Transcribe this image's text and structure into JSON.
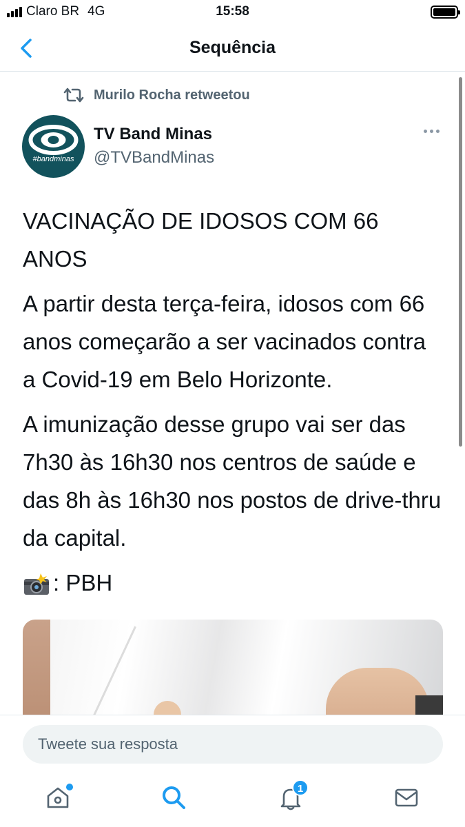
{
  "status_bar": {
    "carrier": "Claro BR",
    "network": "4G",
    "time": "15:58"
  },
  "nav": {
    "title": "Sequência"
  },
  "tweet": {
    "retweeted_by": "Murilo Rocha retweetou",
    "avatar_text": "#bandminas",
    "author_name": "TV Band Minas",
    "author_handle": "@TVBandMinas",
    "paragraphs": [
      "VACINAÇÃO DE IDOSOS COM 66 ANOS",
      "A partir desta terça-feira, idosos com 66 anos começarão a ser vacinados contra a Covid-19 em Belo Horizonte.",
      "A imunização desse grupo vai ser das 7h30 às 16h30 nos centros de saúde e das 8h às 16h30 nos postos de drive-thru da capital."
    ],
    "photo_credit": ": PBH"
  },
  "reply": {
    "placeholder": "Tweete sua resposta"
  },
  "tabbar": {
    "notifications_badge": "1"
  },
  "colors": {
    "accent": "#1d9bf0",
    "secondary_text": "#536471",
    "avatar_bg": "#12525c"
  }
}
